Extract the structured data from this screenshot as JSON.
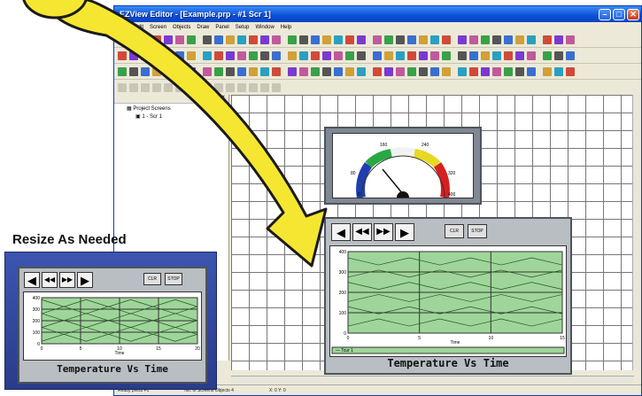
{
  "window": {
    "title": "EZView Editor - [Example.prp - #1 Scr 1]",
    "menu": [
      "File",
      "Edit",
      "Screen",
      "Objects",
      "Draw",
      "Panel",
      "Setup",
      "Window",
      "Help"
    ],
    "min_symbol": "–",
    "max_symbol": "□",
    "close_symbol": "✕"
  },
  "tree": {
    "header": "■ ×",
    "root": "Project Screens",
    "item": "1 - Scr 1"
  },
  "gauge": {
    "ticks": [
      "0",
      "80",
      "160",
      "240",
      "320",
      "400"
    ],
    "value": 150
  },
  "trend": {
    "clr_label": "CLR",
    "stop_label": "STOP",
    "title": "Temperature Vs Time",
    "xlabel": "Time",
    "y_ticks": [
      "400",
      "300",
      "200",
      "100",
      "0"
    ],
    "x_ticks": [
      "0",
      "5",
      "10",
      "15"
    ],
    "legend": "Tcur 1"
  },
  "preview": {
    "label": "Resize As Needed",
    "clr_label": "CLR",
    "stop_label": "STOP",
    "title": "Temperature Vs Time",
    "xlabel": "Time",
    "y_ticks": [
      "400",
      "300",
      "200",
      "100",
      "0"
    ],
    "x_ticks": [
      "0",
      "5",
      "10",
      "15",
      "20"
    ]
  },
  "status": {
    "left": "Ready  press F1",
    "mid": "No. of Screens  Objects 4",
    "right": "X: 0  Y: 0"
  },
  "colors": {
    "arrow": "#f5e632",
    "chart_bg": "#9fd59a",
    "panel_bg": "#b9bec3",
    "preview_bg": "#2f479e"
  }
}
